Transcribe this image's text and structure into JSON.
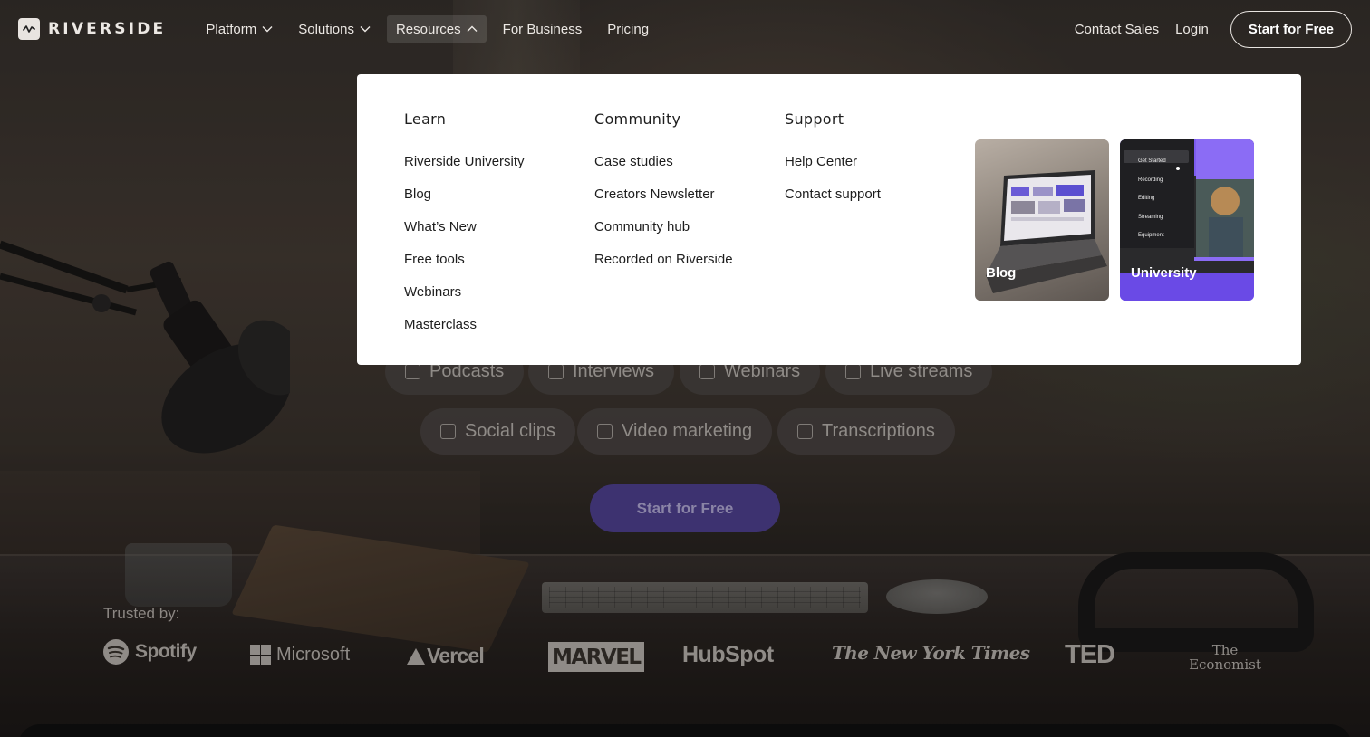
{
  "nav": {
    "logo_text": "RIVERSIDE",
    "items": [
      {
        "label": "Platform",
        "has_chevron": true
      },
      {
        "label": "Solutions",
        "has_chevron": true
      },
      {
        "label": "Resources",
        "has_chevron": true,
        "active": true
      },
      {
        "label": "For Business"
      },
      {
        "label": "Pricing"
      }
    ],
    "contact_sales": "Contact Sales",
    "login": "Login",
    "cta": "Start for Free"
  },
  "dropdown": {
    "columns": [
      {
        "title": "Learn",
        "links": [
          "Riverside University",
          "Blog",
          "What’s New",
          "Free tools",
          "Webinars",
          "Masterclass"
        ]
      },
      {
        "title": "Community",
        "links": [
          "Case studies",
          "Creators Newsletter",
          "Community hub",
          "Recorded on Riverside"
        ]
      },
      {
        "title": "Support",
        "links": [
          "Help Center",
          "Contact support"
        ]
      }
    ],
    "cards": [
      {
        "label": "Blog"
      },
      {
        "label": "University",
        "menu": [
          "Get Started",
          "Recording",
          "Editing",
          "Streaming",
          "Equipment"
        ]
      }
    ]
  },
  "hero": {
    "chips_row1": [
      "Podcasts",
      "Interviews",
      "Webinars",
      "Live streams"
    ],
    "chips_row2": [
      "Social clips",
      "Video marketing",
      "Transcriptions"
    ],
    "cta": "Start for Free"
  },
  "trusted": {
    "label": "Trusted by:",
    "brands": [
      "Spotify",
      "Microsoft",
      "Vercel",
      "MARVEL",
      "HubSpot",
      "The New York Times",
      "TED",
      "The Economist"
    ]
  },
  "colors": {
    "accent": "#5b45d6",
    "dropdown_bg": "#ffffff",
    "overlay": "#000000"
  }
}
